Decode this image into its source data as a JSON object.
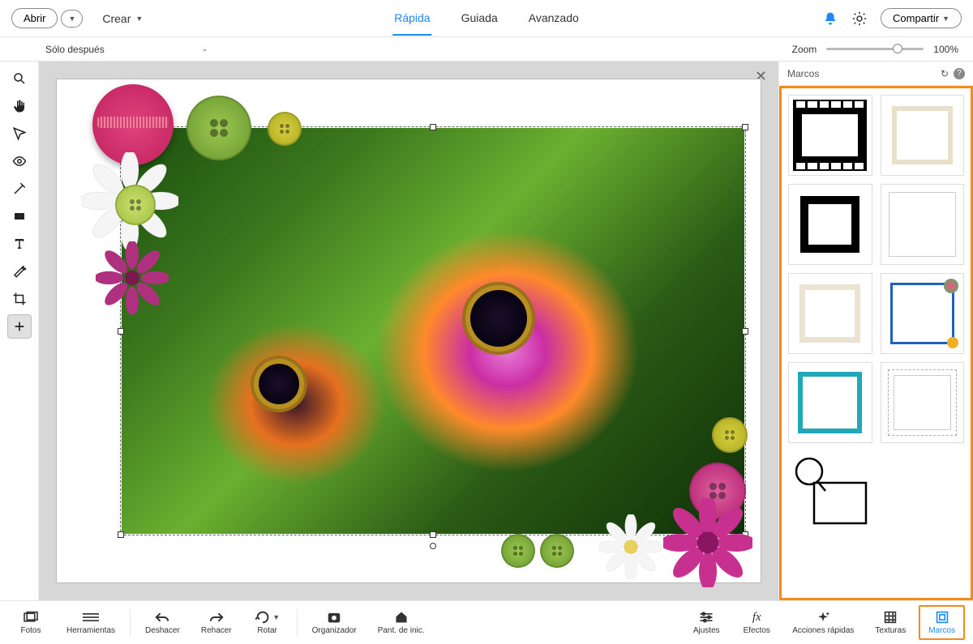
{
  "topbar": {
    "open_label": "Abrir",
    "create_label": "Crear",
    "share_label": "Compartir"
  },
  "modes": {
    "quick": "Rápida",
    "guided": "Guiada",
    "expert": "Avanzado",
    "active": "quick"
  },
  "subbar": {
    "view_label": "Sólo después",
    "zoom_label": "Zoom",
    "zoom_value": "100%"
  },
  "panel": {
    "title": "Marcos"
  },
  "frames": [
    {
      "name": "film-strip"
    },
    {
      "name": "cream-border"
    },
    {
      "name": "black-border"
    },
    {
      "name": "thin-border"
    },
    {
      "name": "paper-border"
    },
    {
      "name": "colorful-corners"
    },
    {
      "name": "teal-dots"
    },
    {
      "name": "postage-stamp"
    },
    {
      "name": "magnifier"
    }
  ],
  "bottombar": {
    "photos": "Fotos",
    "tools": "Herramientas",
    "undo": "Deshacer",
    "redo": "Rehacer",
    "rotate": "Rotar",
    "organizer": "Organizador",
    "home": "Pant. de inic.",
    "adjust": "Ajustes",
    "effects": "Efectos",
    "quick_actions": "Acciones rápidas",
    "textures": "Texturas",
    "frames": "Marcos"
  }
}
